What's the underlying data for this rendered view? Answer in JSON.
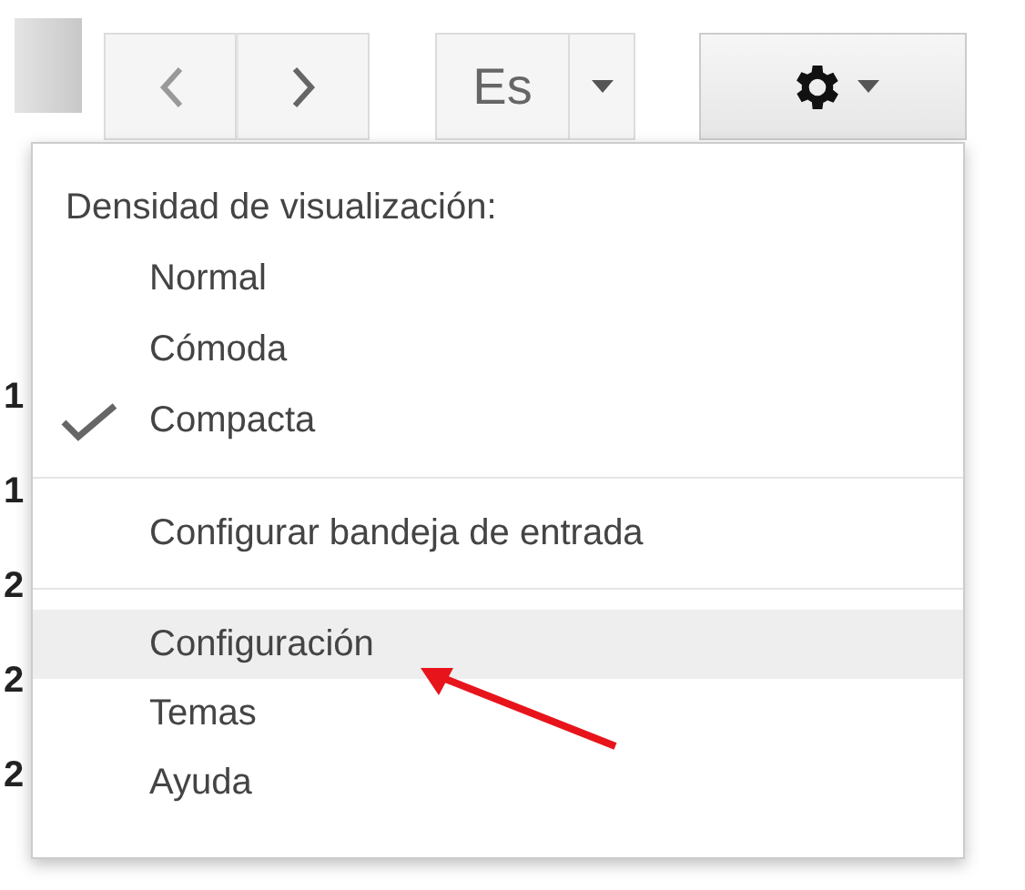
{
  "toolbar": {
    "language_button": "Es"
  },
  "background_rows": [
    "1",
    "1",
    "2",
    "2",
    "2"
  ],
  "menu": {
    "heading": "Densidad de visualización:",
    "density_options": [
      {
        "label": "Normal",
        "checked": false
      },
      {
        "label": "Cómoda",
        "checked": false
      },
      {
        "label": "Compacta",
        "checked": true
      }
    ],
    "inbox_item": {
      "label": "Configurar bandeja de entrada",
      "highlighted": false
    },
    "items": [
      {
        "label": "Configuración",
        "highlighted": true
      },
      {
        "label": "Temas",
        "highlighted": false
      },
      {
        "label": "Ayuda",
        "highlighted": false
      }
    ]
  }
}
